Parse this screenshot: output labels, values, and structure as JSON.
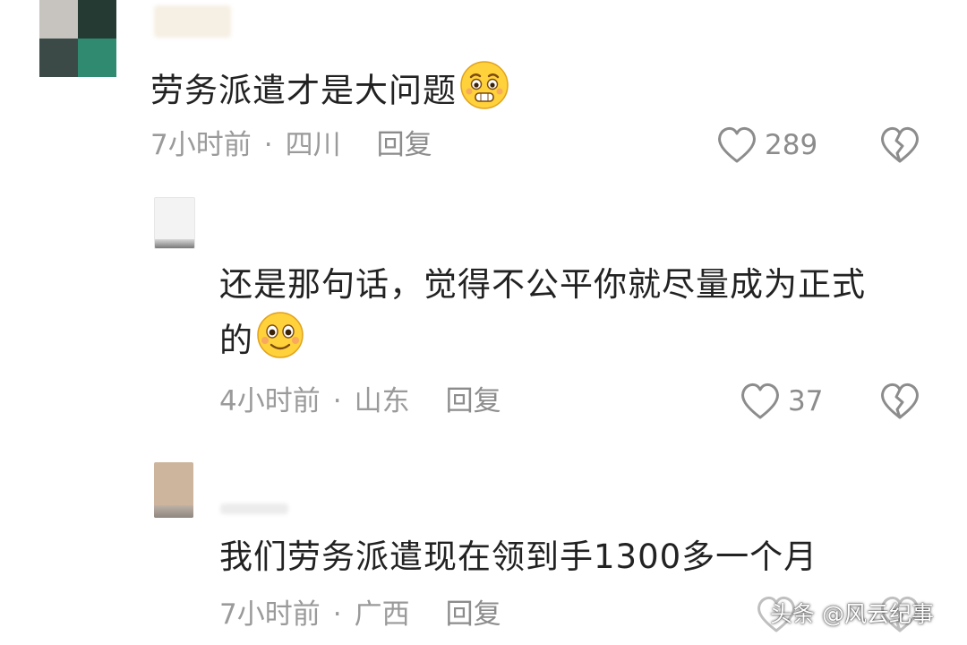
{
  "comments": [
    {
      "text": "劳务派遣才是大问题",
      "emoji": "nervous-face",
      "time": "7小时前",
      "location": "四川",
      "reply_label": "回复",
      "likes": "289"
    },
    {
      "text_line1": "还是那句话，觉得不公平你就尽量成为正式",
      "text_line2": "的",
      "emoji": "smiling-face",
      "time": "4小时前",
      "location": "山东",
      "reply_label": "回复",
      "likes": "37"
    },
    {
      "text": "我们劳务派遣现在领到手1300多一个月",
      "time": "7小时前",
      "location": "广西",
      "reply_label": "回复"
    }
  ],
  "separator": "·",
  "watermark": "头条 @风云纪事",
  "icons": {
    "like": "heart-outline-icon",
    "dislike": "broken-heart-icon"
  },
  "colors": {
    "text": "#222222",
    "meta": "#9a9a9a",
    "icon": "#8c8c8c",
    "background": "#ffffff"
  }
}
